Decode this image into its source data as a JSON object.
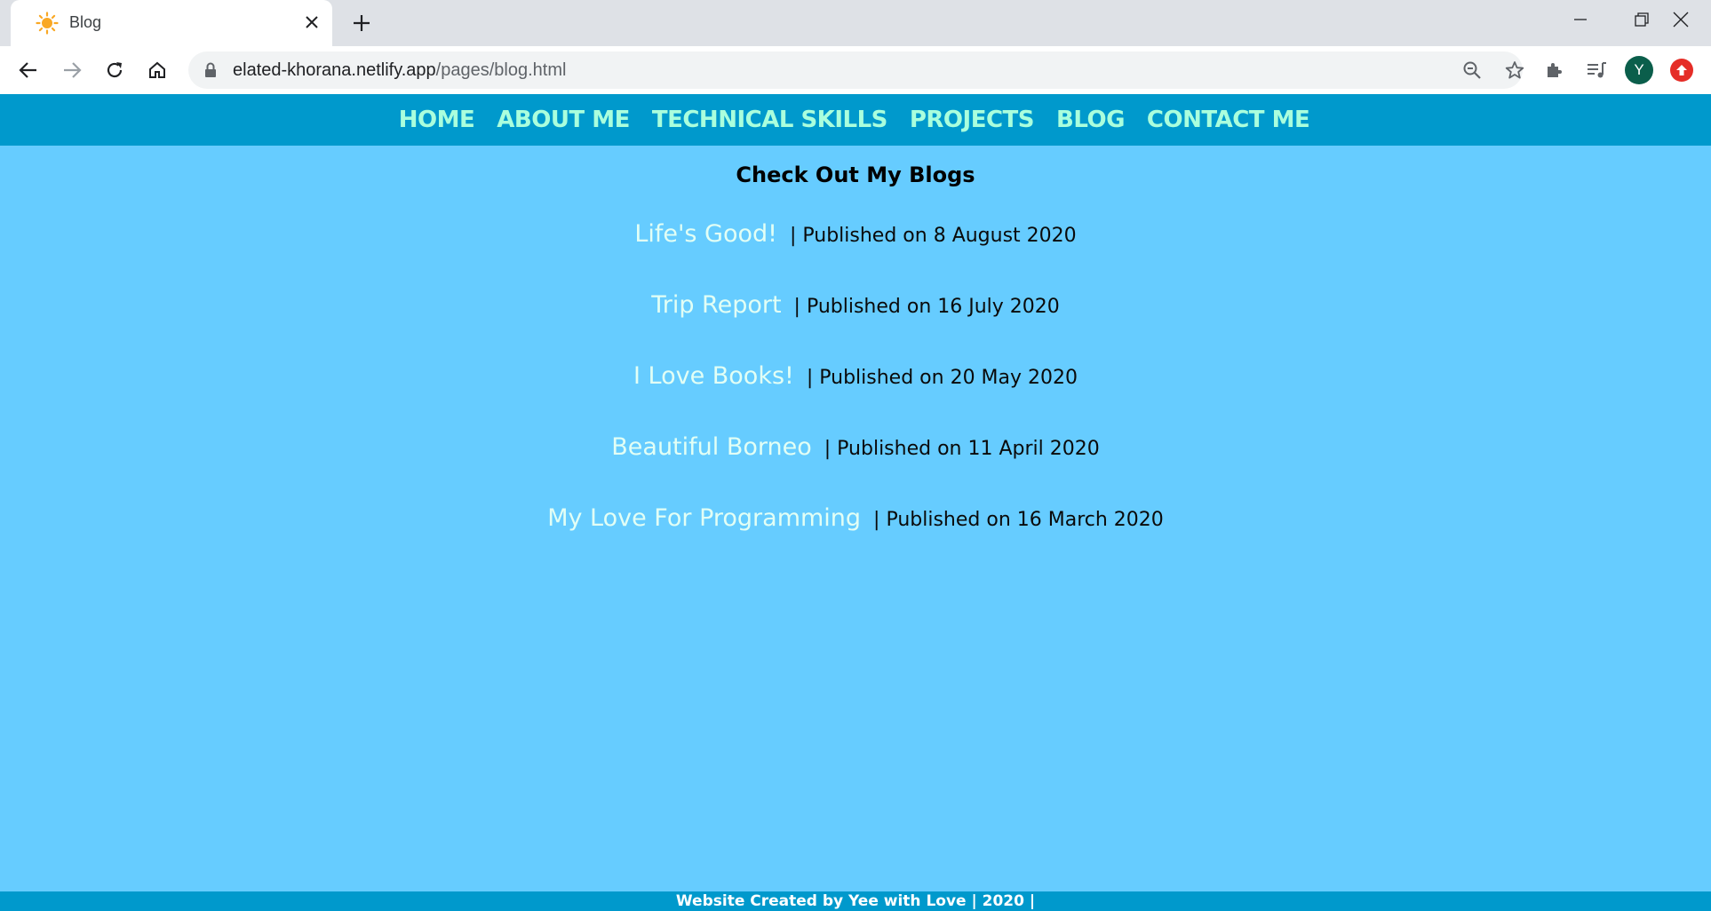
{
  "browser": {
    "tab": {
      "title": "Blog",
      "favicon": "sun-icon"
    },
    "url": {
      "domain": "elated-khorana.netlify.app",
      "path": "/pages/blog.html"
    },
    "profile_initial": "Y",
    "colors": {
      "tabstrip": "#dee1e6",
      "omnibox": "#f1f3f4",
      "avatar": "#0b5e4b",
      "update": "#e52d27"
    }
  },
  "nav": {
    "items": [
      {
        "label": "HOME"
      },
      {
        "label": "ABOUT ME"
      },
      {
        "label": "TECHNICAL SKILLS"
      },
      {
        "label": "PROJECTS"
      },
      {
        "label": "BLOG"
      },
      {
        "label": "CONTACT ME"
      }
    ]
  },
  "page": {
    "heading": "Check Out My Blogs",
    "posts": [
      {
        "title": "Life's Good!",
        "meta": "| Published on 8 August 2020"
      },
      {
        "title": "Trip Report",
        "meta": "| Published on 16 July 2020"
      },
      {
        "title": "I Love Books!",
        "meta": "| Published on 20 May 2020"
      },
      {
        "title": "Beautiful Borneo",
        "meta": "| Published on 11 April 2020"
      },
      {
        "title": "My Love For Programming",
        "meta": "| Published on 16 March 2020"
      }
    ]
  },
  "footer": {
    "text": "Website Created by Yee with Love | 2020 |"
  },
  "colors": {
    "page_bg": "#66ccff",
    "nav_bg": "#0099cc",
    "nav_text": "#aaffdd",
    "post_title": "#e2fff5"
  }
}
